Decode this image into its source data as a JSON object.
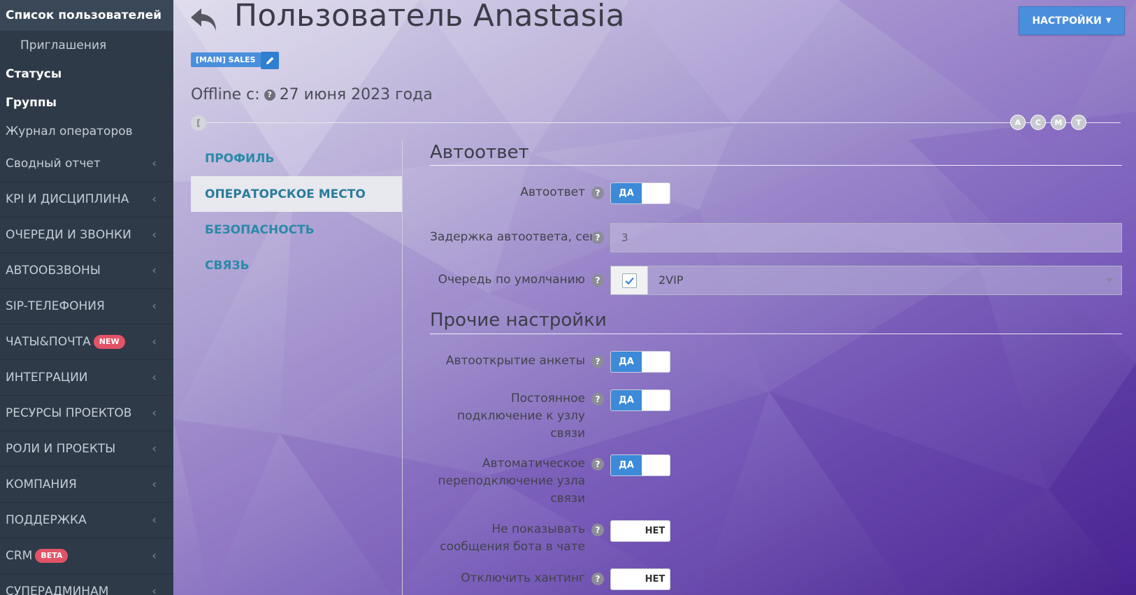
{
  "sidebar": {
    "items": [
      {
        "label": "Список пользователей"
      },
      {
        "label": "Приглашения"
      },
      {
        "label": "Статусы"
      },
      {
        "label": "Группы"
      },
      {
        "label": "Журнал операторов"
      },
      {
        "label": "Сводный отчет"
      },
      {
        "label": "KPI И ДИСЦИПЛИНА"
      },
      {
        "label": "ОЧЕРЕДИ И ЗВОНКИ"
      },
      {
        "label": "АВТООБЗВОНЫ"
      },
      {
        "label": "SIP-ТЕЛЕФОНИЯ"
      },
      {
        "label": "ЧАТЫ&ПОЧТА",
        "badge": "NEW"
      },
      {
        "label": "ИНТЕГРАЦИИ"
      },
      {
        "label": "РЕСУРСЫ ПРОЕКТОВ"
      },
      {
        "label": "РОЛИ И ПРОЕКТЫ"
      },
      {
        "label": "КОМПАНИЯ"
      },
      {
        "label": "ПОДДЕРЖКА"
      },
      {
        "label": "CRM",
        "badge": "BETA"
      },
      {
        "label": "СУПЕРАДМИНАМ"
      }
    ]
  },
  "header": {
    "title": "Пользователь Anastasia",
    "settings_label": "НАСТРОЙКИ",
    "tag": "[MAIN] SALES",
    "offline_label": "Offline с:",
    "offline_date": "27 июня 2023 года"
  },
  "timeline": {
    "start_label": "[",
    "markers": [
      "A",
      "C",
      "M",
      "T"
    ]
  },
  "tabs": [
    {
      "label": "ПРОФИЛЬ"
    },
    {
      "label": "ОПЕРАТОРСКОЕ МЕСТО"
    },
    {
      "label": "БЕЗОПАСНОСТЬ"
    },
    {
      "label": "СВЯЗЬ"
    }
  ],
  "form": {
    "section_autoreply": "Автоответ",
    "section_other": "Прочие настройки",
    "toggle_on": "ДА",
    "toggle_off": "НЕТ",
    "autoreply_label": "Автоответ",
    "delay_label": "Задержка автоответа, сек",
    "delay_value": "3",
    "queue_label": "Очередь по умолчанию",
    "queue_value": "2VIP",
    "autoopen_label": "Автооткрытие анкеты",
    "persistent_label_1": "Постоянное",
    "persistent_label_2": "подключение к узлу",
    "persistent_label_3": "связи",
    "autoreconnect_label_1": "Автоматическое",
    "autoreconnect_label_2": "переподключение узла",
    "autoreconnect_label_3": "связи",
    "hidebot_label_1": "Не показывать",
    "hidebot_label_2": "сообщения бота в чате",
    "hunting_label": "Отключить хантинг"
  },
  "colors": {
    "sidebar_bg": "#2e3a48",
    "accent": "#4a8fdc",
    "tab_text": "#2a8aa8",
    "badge_red": "#e25365"
  }
}
